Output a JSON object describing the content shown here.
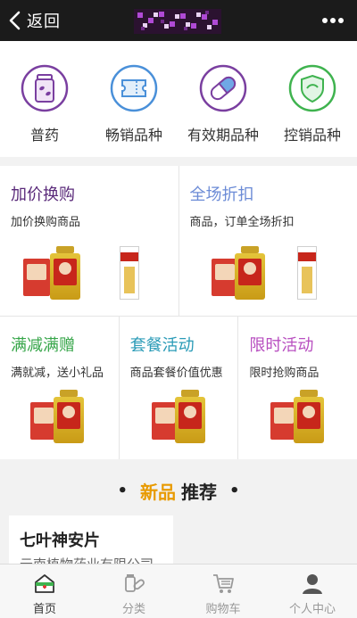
{
  "header": {
    "back_label": "返回",
    "accent": "#1b1b1b"
  },
  "categories": [
    {
      "label": "普药",
      "icon": "pill-bottle-icon",
      "color": "#7a3fa0"
    },
    {
      "label": "畅销品种",
      "icon": "ticket-icon",
      "color": "#4a90d9"
    },
    {
      "label": "有效期品种",
      "icon": "capsule-icon",
      "color": "#7a3fa0"
    },
    {
      "label": "控销品种",
      "icon": "shield-icon",
      "color": "#3fb34f"
    }
  ],
  "promos": [
    {
      "title": "加价换购",
      "subtitle": "加价换购商品",
      "color": "#5a2a7a"
    },
    {
      "title": "全场折扣",
      "subtitle": "商品，订单全场折扣",
      "color": "#6b8bd6"
    },
    {
      "title": "满减满赠",
      "subtitle": "满就减，送小礼品",
      "color": "#37a64a"
    },
    {
      "title": "套餐活动",
      "subtitle": "商品套餐价值优惠",
      "color": "#2a9bb7"
    },
    {
      "title": "限时活动",
      "subtitle": "限时抢购商品",
      "color": "#b84fc0"
    }
  ],
  "new_section": {
    "title_highlight": "新品",
    "title_rest": "推荐",
    "dot": "•"
  },
  "product_card": {
    "name": "七叶神安片",
    "company": "云南植物药业有限公司"
  },
  "tabs": [
    {
      "label": "首页",
      "icon": "home-icon",
      "active": true
    },
    {
      "label": "分类",
      "icon": "category-icon",
      "active": false
    },
    {
      "label": "购物车",
      "icon": "cart-icon",
      "active": false
    },
    {
      "label": "个人中心",
      "icon": "user-icon",
      "active": false
    }
  ]
}
